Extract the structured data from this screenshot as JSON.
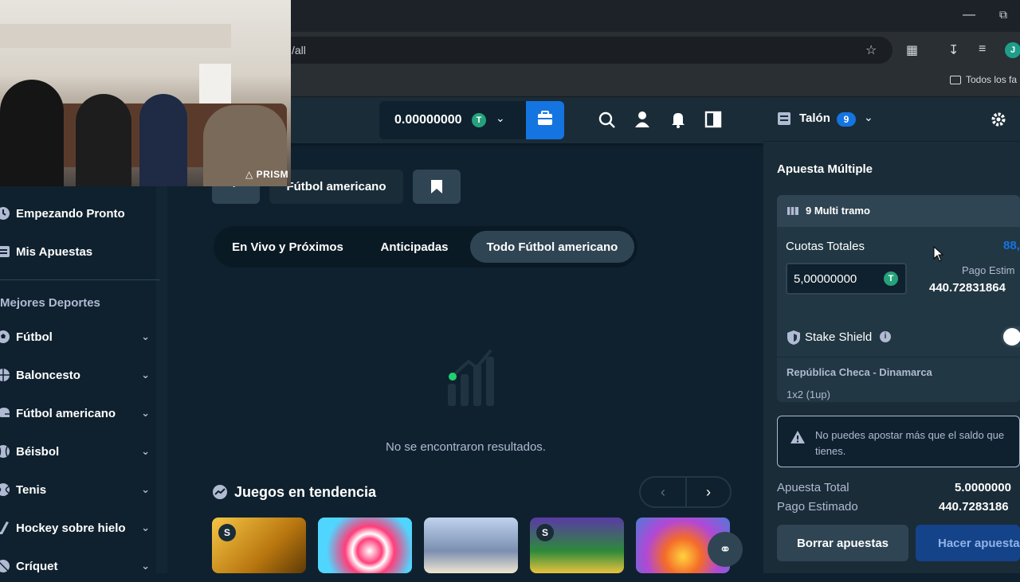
{
  "browser": {
    "url_fragment": "/all",
    "bookmarks_folder": "Todos los fa",
    "profile_initial": "J"
  },
  "overlay": {
    "watermark": "PRISM"
  },
  "header": {
    "balance": "0.00000000",
    "currency_symbol": "T"
  },
  "breadcrumb": {
    "current": "Fútbol americano"
  },
  "sidebar": {
    "items": [
      {
        "label": "Empezando Pronto"
      },
      {
        "label": "Mis Apuestas"
      }
    ],
    "section_title": "Mejores Deportes",
    "sports": [
      {
        "label": "Fútbol"
      },
      {
        "label": "Baloncesto"
      },
      {
        "label": "Fútbol americano"
      },
      {
        "label": "Béisbol"
      },
      {
        "label": "Tenis"
      },
      {
        "label": "Hockey sobre hielo"
      },
      {
        "label": "Críquet"
      }
    ]
  },
  "tabs": [
    {
      "label": "En Vivo y Próximos"
    },
    {
      "label": "Anticipadas"
    },
    {
      "label": "Todo Fútbol americano",
      "active": true
    }
  ],
  "empty_state": "No se encontraron resultados.",
  "trending": {
    "title": "Juegos en tendencia"
  },
  "betslip": {
    "title": "Talón",
    "count": "9",
    "section": "Apuesta Múltiple",
    "multi_label": "9 Multi tramo",
    "total_odds_label": "Cuotas Totales",
    "total_odds_value": "88,",
    "stake": "5,00000000",
    "estimated_label": "Pago Estim",
    "estimated_value": "440.72831864",
    "shield_label": "Stake Shield",
    "match": "República Checa - Dinamarca",
    "market": "1x2 (1up)",
    "warning": "No puedes apostar más que el saldo que tienes.",
    "total_bet_label": "Apuesta Total",
    "total_bet_value": "5.0000000",
    "payout_label": "Pago Estimado",
    "payout_value": "440.7283186",
    "clear_button": "Borrar apuestas",
    "place_button": "Hacer apuesta"
  },
  "colors": {
    "accent_blue": "#1475e1",
    "tether_green": "#26a17b",
    "bg_dark": "#0f212e",
    "panel": "#1a2c38"
  }
}
